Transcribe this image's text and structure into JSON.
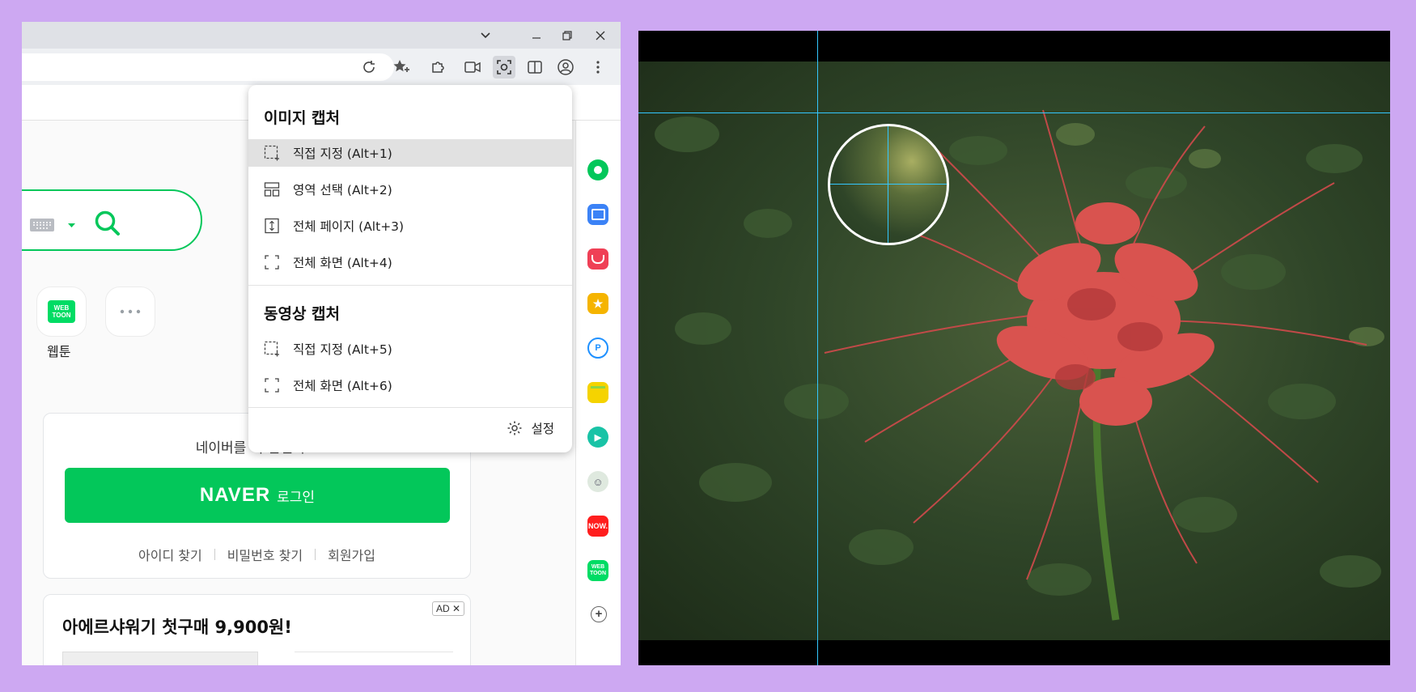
{
  "browser": {
    "titlebar": {
      "icons": [
        "chevron-down-icon",
        "minimize-icon",
        "restore-icon",
        "close-icon"
      ]
    },
    "toolbar": {
      "icons": [
        "reload-icon",
        "favorite-star-icon",
        "extensions-puzzle-icon",
        "video-capture-icon",
        "screen-capture-icon",
        "split-view-icon",
        "profile-icon",
        "more-vertical-icon"
      ]
    }
  },
  "page": {
    "apps": [
      {
        "label": "웹툰",
        "badge_line1": "WEB",
        "badge_line2": "TOON"
      }
    ],
    "login": {
      "message": "네이버를 더 안전하고",
      "logo": "NAVER",
      "button_suffix": "로그인",
      "links": [
        "아이디 찾기",
        "비밀번호 찾기",
        "회원가입"
      ]
    },
    "ad": {
      "title": "아에르샤워기 첫구매 9,900원!",
      "badge": "AD ✕"
    }
  },
  "sidebar": {
    "icons": [
      {
        "name": "naver-green-circle-icon",
        "color": "#03c75a"
      },
      {
        "name": "briefcase-icon",
        "color": "#3b82f6"
      },
      {
        "name": "pocket-icon",
        "color": "#ef4056"
      },
      {
        "name": "star-bookmark-icon",
        "color": "#f5b400"
      },
      {
        "name": "papago-icon",
        "color": "#1e90ff"
      },
      {
        "name": "memo-icon",
        "color": "#f5d300"
      },
      {
        "name": "play-icon",
        "color": "#19c3a6"
      },
      {
        "name": "character-icon",
        "color": "#7a9a7a"
      },
      {
        "name": "now-icon",
        "color": "#ff1e1e",
        "text": "NOW."
      },
      {
        "name": "webtoon-icon",
        "color": "#00dc64",
        "text": "WEB TOON"
      },
      {
        "name": "add-icon",
        "color": "#666666"
      }
    ]
  },
  "capture_menu": {
    "image_title": "이미지 캡처",
    "image_items": [
      "직접 지정 (Alt+1)",
      "영역 선택 (Alt+2)",
      "전체 페이지 (Alt+3)",
      "전체 화면 (Alt+4)"
    ],
    "video_title": "동영상 캡처",
    "video_items": [
      "직접 지정 (Alt+5)",
      "전체 화면 (Alt+6)"
    ],
    "settings_label": "설정"
  },
  "colors": {
    "accent": "#03c75a",
    "guide": "#33c7ff",
    "background": "#cda8f2"
  }
}
